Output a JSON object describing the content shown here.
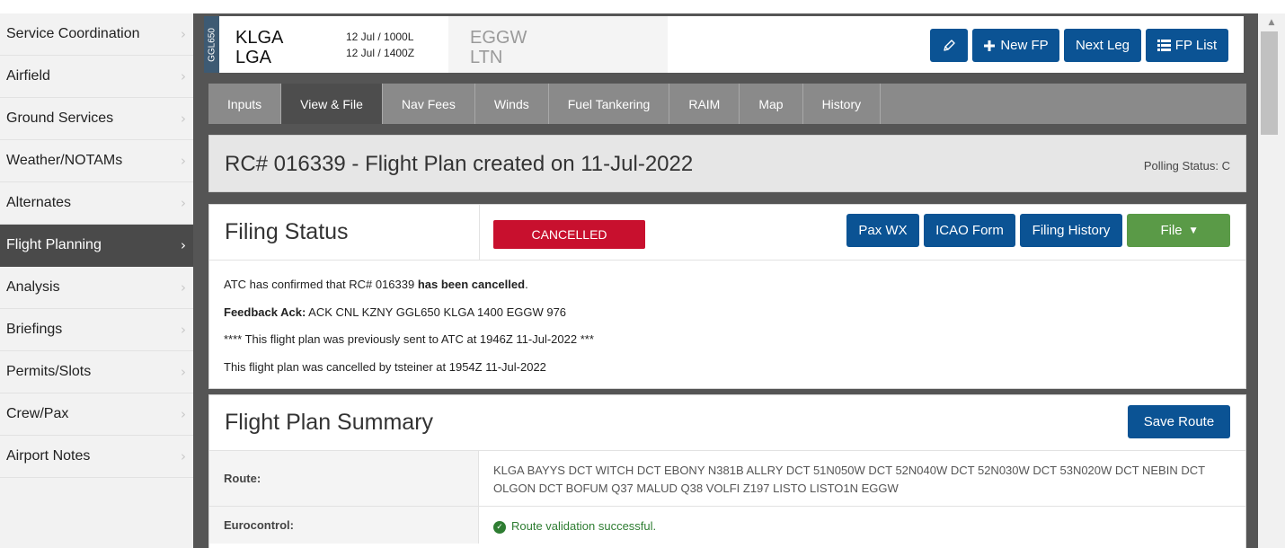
{
  "sidebar": {
    "items": [
      {
        "label": "Service Coordination"
      },
      {
        "label": "Airfield"
      },
      {
        "label": "Ground Services"
      },
      {
        "label": "Weather/NOTAMs"
      },
      {
        "label": "Alternates"
      },
      {
        "label": "Flight Planning",
        "active": true
      },
      {
        "label": "Analysis"
      },
      {
        "label": "Briefings"
      },
      {
        "label": "Permits/Slots"
      },
      {
        "label": "Crew/Pax"
      },
      {
        "label": "Airport Notes"
      }
    ],
    "chevron": "›"
  },
  "header": {
    "aircraft_tag": "GGL650",
    "origin": {
      "icao": "KLGA",
      "iata": "LGA",
      "date_local": "12 Jul / 1000L",
      "date_utc": "12 Jul / 1400Z"
    },
    "destination": {
      "icao": "EGGW",
      "iata": "LTN"
    },
    "buttons": {
      "edit_icon": "pencil-icon",
      "new_fp": "New FP",
      "next_leg": "Next Leg",
      "fp_list": "FP List"
    }
  },
  "tabs": [
    "Inputs",
    "View & File",
    "Nav Fees",
    "Winds",
    "Fuel Tankering",
    "RAIM",
    "Map",
    "History"
  ],
  "active_tab": "View & File",
  "title_panel": {
    "title": "RC# 016339 - Flight Plan created on 11-Jul-2022",
    "polling": "Polling Status: C"
  },
  "filing_status": {
    "title": "Filing Status",
    "badge": "CANCELLED",
    "buttons": {
      "pax_wx": "Pax WX",
      "icao_form": "ICAO Form",
      "filing_history": "Filing History",
      "file": "File"
    },
    "line1_pre": "ATC has confirmed that RC# 016339 ",
    "line1_bold": "has been cancelled",
    "line1_post": ".",
    "line2_bold": "Feedback Ack:",
    "line2_text": " ACK CNL KZNY GGL650 KLGA 1400 EGGW 976",
    "line3": "**** This flight plan was previously sent to ATC at 1946Z 11-Jul-2022 ***",
    "line4": "This flight plan was cancelled by tsteiner at 1954Z 11-Jul-2022"
  },
  "summary": {
    "title": "Flight Plan Summary",
    "save_route": "Save Route",
    "route_label": "Route:",
    "route_value": "KLGA BAYYS DCT WITCH DCT EBONY N381B ALLRY DCT 51N050W DCT 52N040W DCT 52N030W DCT 53N020W DCT NEBIN DCT OLGON DCT BOFUM Q37 MALUD Q38 VOLFI Z197 LISTO LISTO1N EGGW",
    "eurocontrol_label": "Eurocontrol:",
    "eurocontrol_value": "Route validation successful."
  },
  "colors": {
    "primary_button": "#0b5394",
    "cancelled_badge": "#c8102e",
    "file_button": "#5a9a47",
    "success_text": "#2e7d32",
    "sidebar_active": "#4a4a4a"
  }
}
